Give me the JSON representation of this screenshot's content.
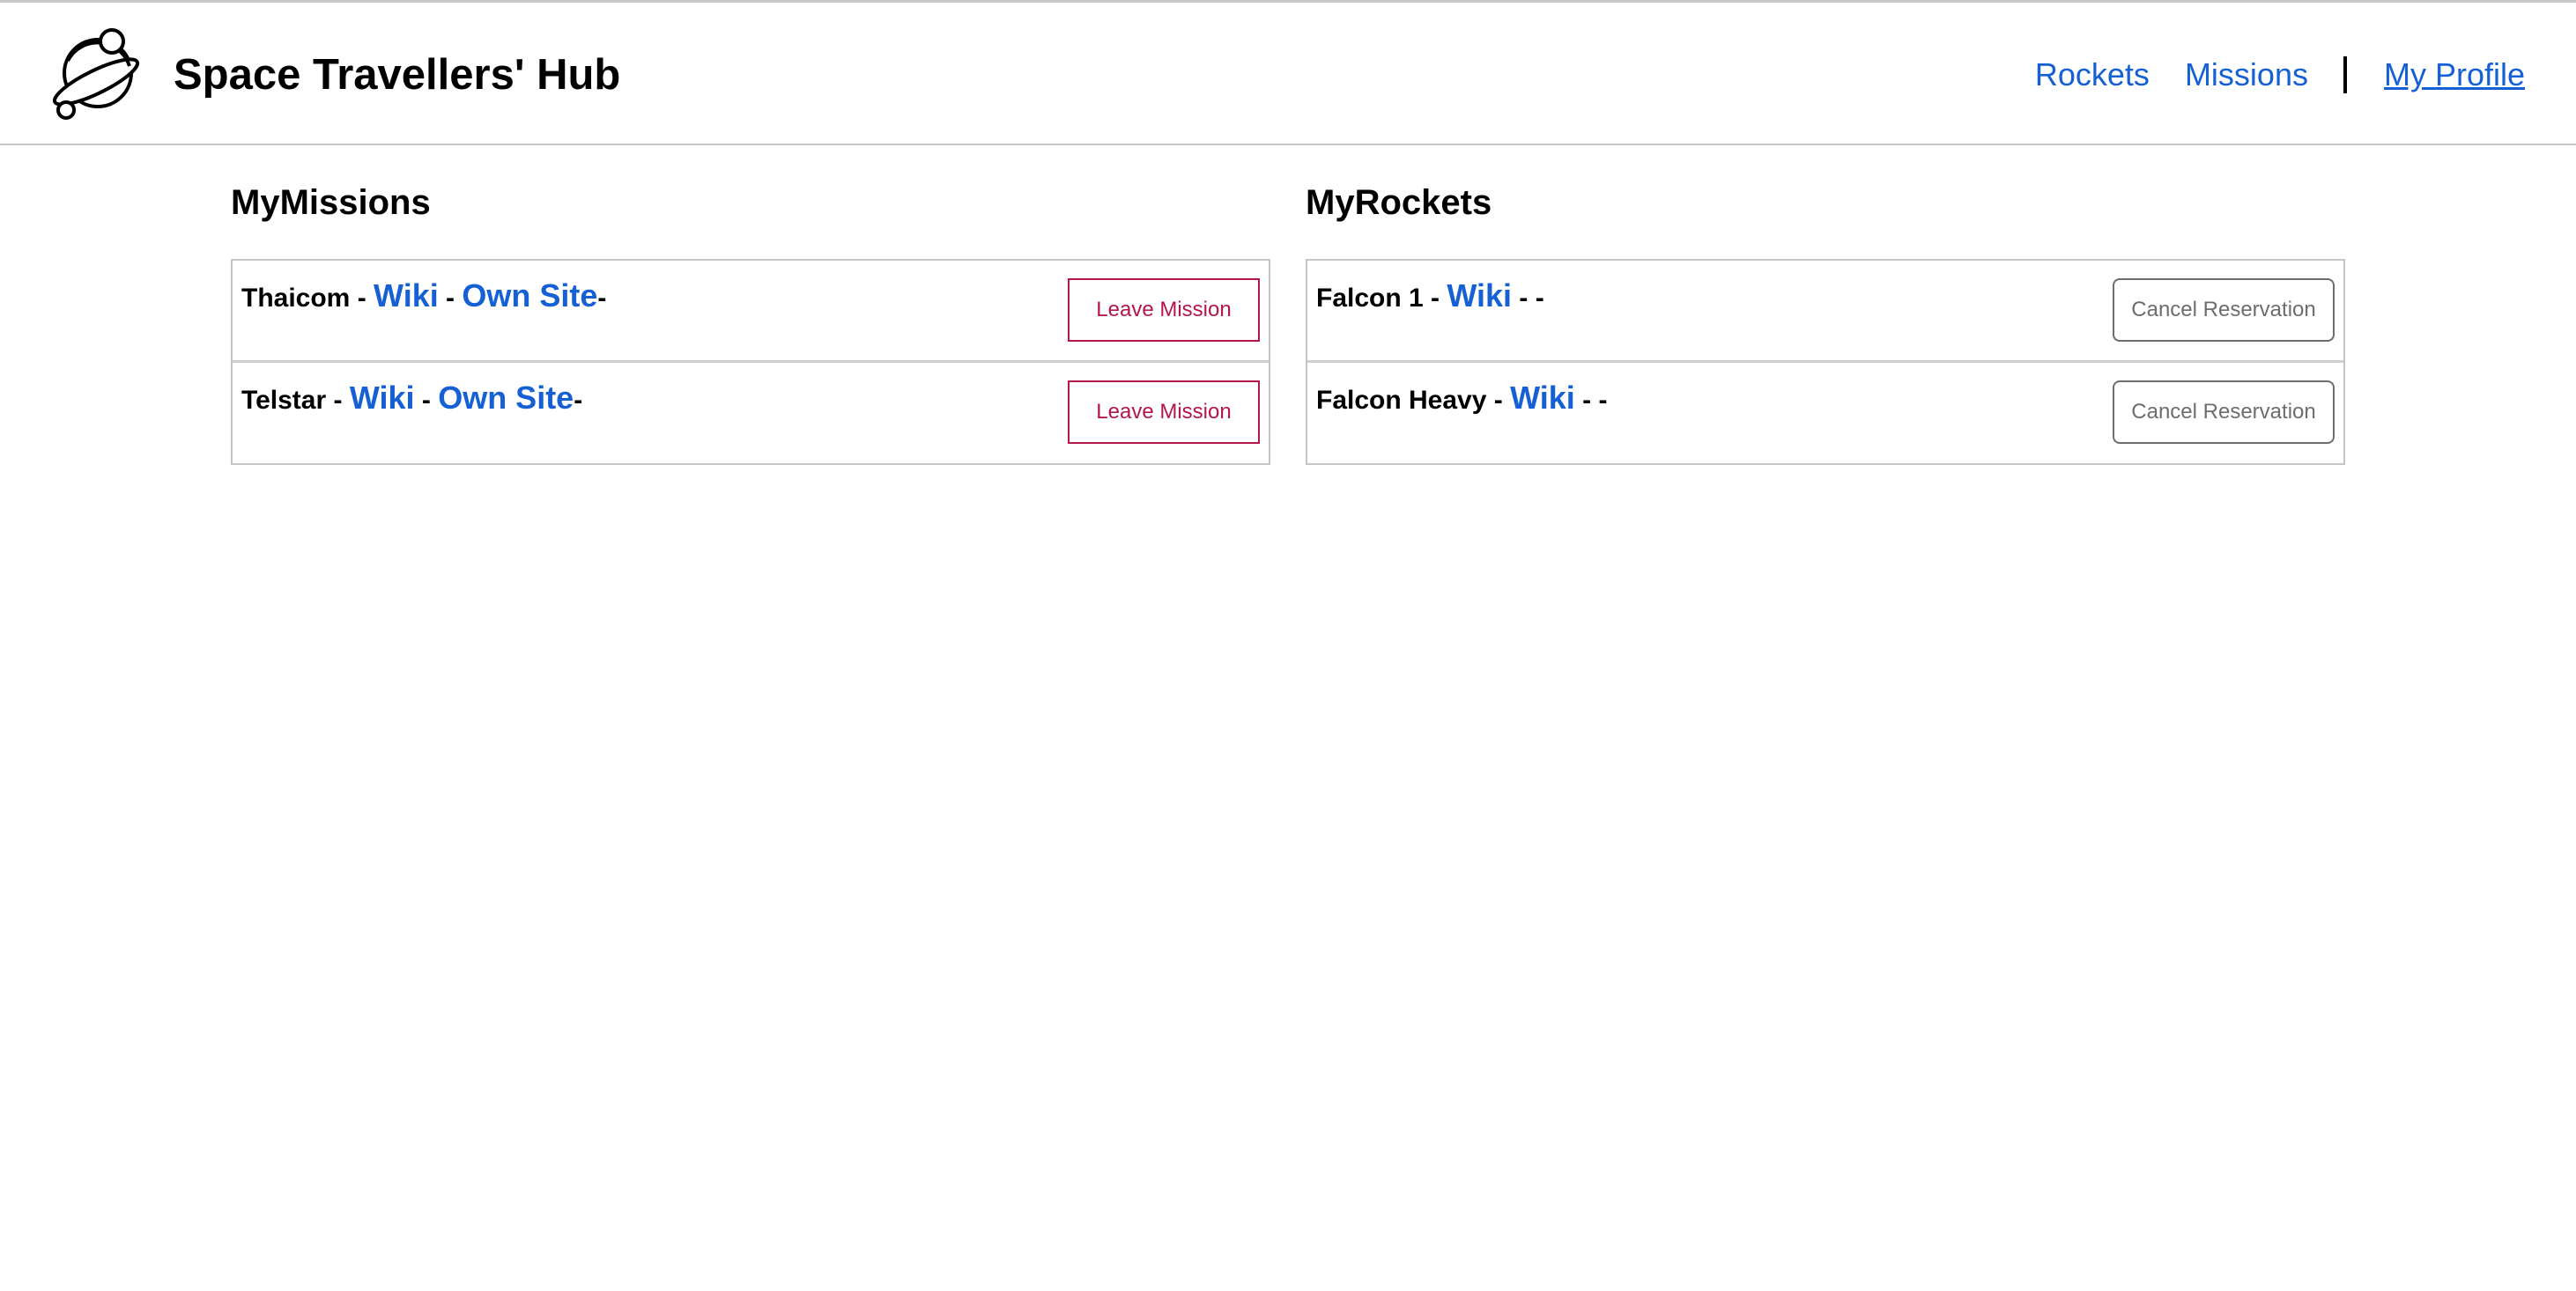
{
  "header": {
    "brand": "Space Travellers' Hub",
    "logo_icon": "planet-icon",
    "nav": {
      "rockets": "Rockets",
      "missions": "Missions",
      "separator": "|",
      "profile": "My Profile"
    }
  },
  "missions": {
    "title": "MyMissions",
    "items": [
      {
        "name": "Thaicom",
        "sep1": " - ",
        "wiki": "Wiki",
        "sep2": " - ",
        "site": "Own Site",
        "tail": "-",
        "button": "Leave Mission"
      },
      {
        "name": "Telstar",
        "sep1": " - ",
        "wiki": "Wiki",
        "sep2": " - ",
        "site": "Own Site",
        "tail": "-",
        "button": "Leave Mission"
      }
    ]
  },
  "rockets": {
    "title": "MyRockets",
    "items": [
      {
        "name": "Falcon 1",
        "sep1": " - ",
        "wiki": "Wiki",
        "tail": " - -",
        "button": "Cancel Reservation"
      },
      {
        "name": "Falcon Heavy",
        "sep1": " - ",
        "wiki": "Wiki",
        "tail": " - -",
        "button": "Cancel Reservation"
      }
    ]
  },
  "colors": {
    "link": "#1560d4",
    "leave": "#b5164a",
    "cancel": "#6d6d6d",
    "border": "#c6c6c6"
  }
}
